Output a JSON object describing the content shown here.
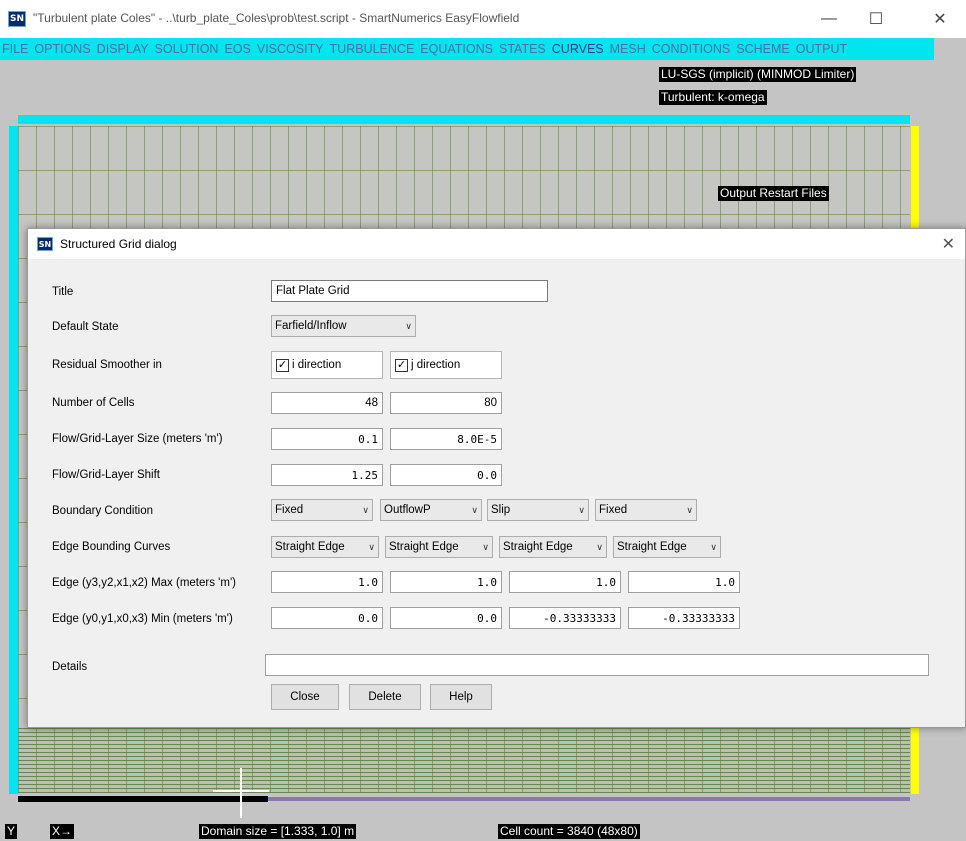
{
  "window": {
    "icon": "SN",
    "title": "\"Turbulent plate Coles\" - ..\\turb_plate_Coles\\prob\\test.script - SmartNumerics EasyFlowfield",
    "minimize": "—",
    "maximize": "☐",
    "close": "✕"
  },
  "menu": [
    "FILE",
    "OPTIONS",
    "DISPLAY",
    "SOLUTION",
    "EOS",
    "VISCOSITY",
    "TURBULENCE",
    "EQUATIONS",
    "STATES",
    "CURVES",
    "MESH",
    "CONDITIONS",
    "SCHEME",
    "OUTPUT"
  ],
  "overlay": {
    "scheme": "LU-SGS (implicit) (MINMOD Limiter)",
    "turbulence": "Turbulent: k-omega",
    "output": "Output Restart Files",
    "axis_y": "Y",
    "axis_x": "X→",
    "domain": "Domain size = [1.333, 1.0] m",
    "cells": "Cell count = 3840 (48x80)"
  },
  "dialog": {
    "icon": "SN",
    "title": "Structured Grid dialog",
    "close": "✕",
    "title_label": "Title",
    "title_value": "Flat Plate Grid",
    "default_state_label": "Default State",
    "default_state_value": "Farfield/Inflow",
    "smoother_label": "Residual Smoother in",
    "smoother_i": "i direction",
    "smoother_j": "j direction",
    "check": "✓",
    "cells_label": "Number of Cells",
    "cells_i": "48",
    "cells_j": "80",
    "layer_size_label": "Flow/Grid-Layer Size (meters 'm')",
    "layer_size_i": "0.1",
    "layer_size_j": "8.0E-5",
    "layer_shift_label": "Flow/Grid-Layer Shift",
    "layer_shift_i": "1.25",
    "layer_shift_j": "0.0",
    "bc_label": "Boundary Condition",
    "bc": [
      "Fixed",
      "OutflowP",
      "Slip",
      "Fixed"
    ],
    "curves_label": "Edge Bounding Curves",
    "curves": [
      "Straight Edge",
      "Straight Edge",
      "Straight Edge",
      "Straight Edge"
    ],
    "max_label": "Edge (y3,y2,x1,x2) Max (meters 'm')",
    "max": [
      "1.0",
      "1.0",
      "1.0",
      "1.0"
    ],
    "min_label": "Edge (y0,y1,x0,x3) Min (meters 'm')",
    "min": [
      "0.0",
      "0.0",
      "-0.33333333",
      "-0.33333333"
    ],
    "details_label": "Details",
    "details_value": "",
    "close_button": "Close",
    "delete_button": "Delete",
    "help_button": "Help",
    "chevron": "∨"
  }
}
